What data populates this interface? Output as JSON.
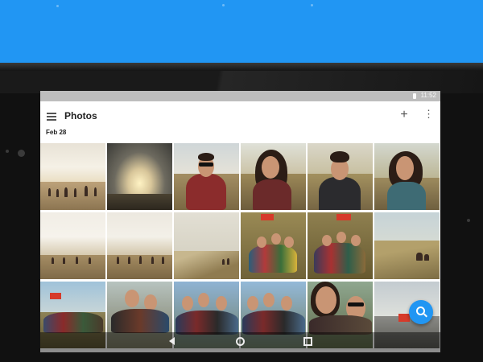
{
  "status_bar": {
    "time": "11:52",
    "battery_icon": "battery-icon"
  },
  "app_bar": {
    "title": "Photos",
    "menu_icon": "hamburger-menu-icon",
    "add_icon": "add-icon",
    "add_glyph": "+",
    "more_icon": "more-vert-icon",
    "more_glyph": "⋮"
  },
  "section": {
    "date_header": "Feb 28"
  },
  "photos": [
    {
      "row": 1,
      "col": 1,
      "subject": "group hiking on hill at sunset"
    },
    {
      "row": 1,
      "col": 2,
      "subject": "cloudy sky over sunset"
    },
    {
      "row": 1,
      "col": 3,
      "subject": "man in sunglasses and plaid shirt"
    },
    {
      "row": 1,
      "col": 4,
      "subject": "woman with long hair"
    },
    {
      "row": 1,
      "col": 5,
      "subject": "man in dark sweater"
    },
    {
      "row": 1,
      "col": 6,
      "subject": "smiling woman with scarf"
    },
    {
      "row": 2,
      "col": 1,
      "subject": "group on hilltop"
    },
    {
      "row": 2,
      "col": 2,
      "subject": "group on hilltop"
    },
    {
      "row": 2,
      "col": 3,
      "subject": "hillside landscape"
    },
    {
      "row": 2,
      "col": 4,
      "subject": "group with red flag"
    },
    {
      "row": 2,
      "col": 5,
      "subject": "group with red flag"
    },
    {
      "row": 2,
      "col": 6,
      "subject": "people on grassy hill"
    },
    {
      "row": 3,
      "col": 1,
      "subject": "group with flag"
    },
    {
      "row": 3,
      "col": 2,
      "subject": "group selfie"
    },
    {
      "row": 3,
      "col": 3,
      "subject": "group selfie"
    },
    {
      "row": 3,
      "col": 4,
      "subject": "group selfie"
    },
    {
      "row": 3,
      "col": 5,
      "subject": "close-up selfie"
    },
    {
      "row": 3,
      "col": 6,
      "subject": "landscape"
    }
  ],
  "fab": {
    "icon": "search-icon"
  },
  "nav_bar": {
    "back_icon": "back-icon",
    "home_icon": "home-icon",
    "recents_icon": "recents-icon"
  },
  "colors": {
    "accent": "#2196f3",
    "status_bar": "#bdbdbd",
    "title_text": "#212121"
  }
}
